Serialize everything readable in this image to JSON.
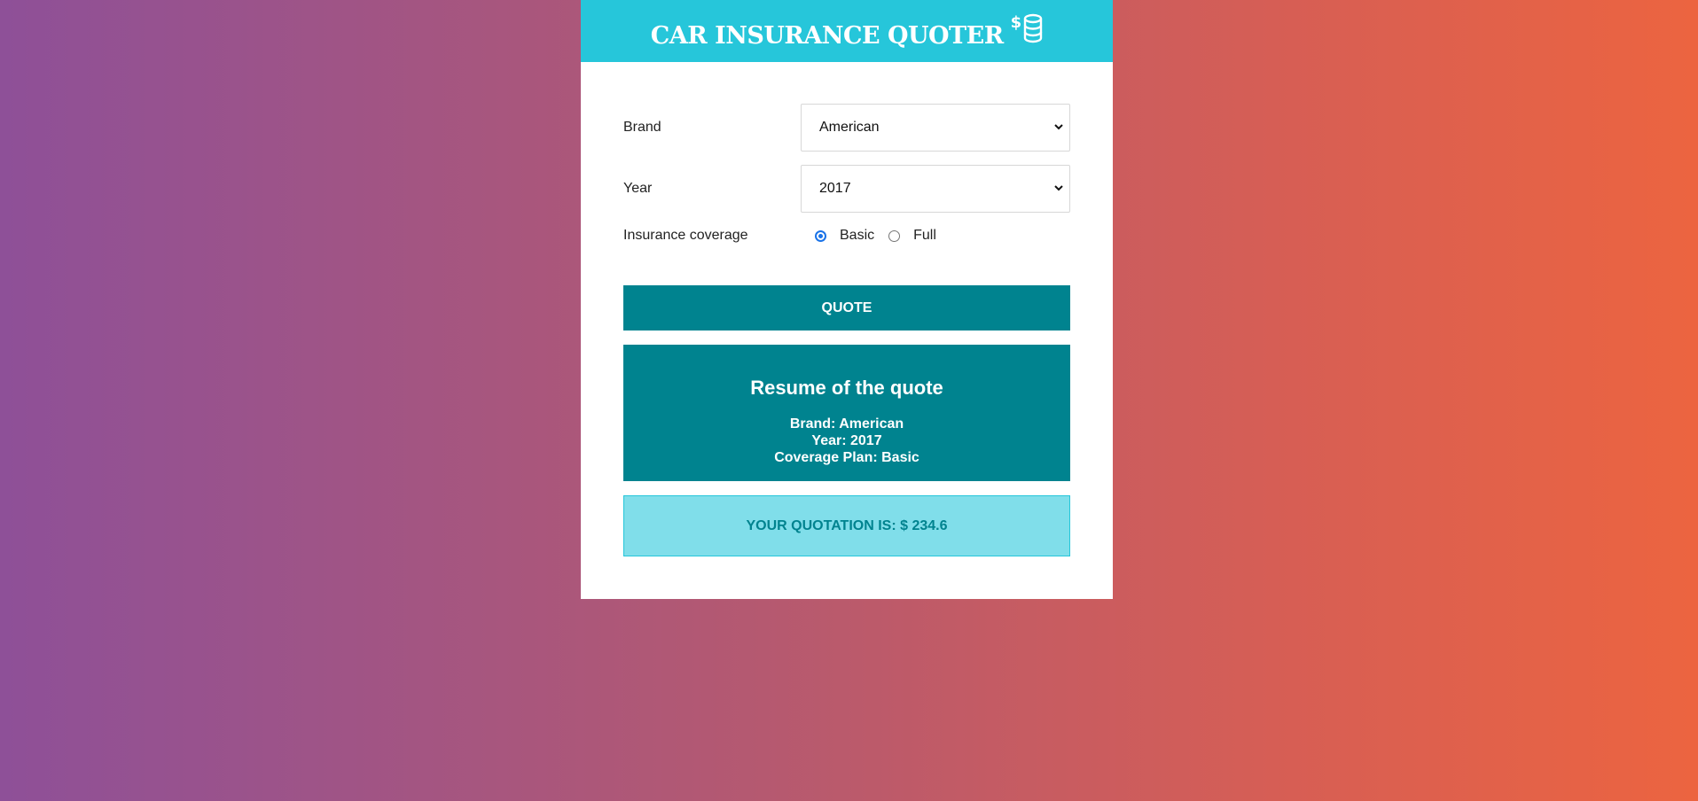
{
  "header": {
    "title": "CAR INSURANCE QUOTER",
    "icon_dollar": "$",
    "icon": "coins-icon"
  },
  "form": {
    "brand": {
      "label": "Brand",
      "value": "American"
    },
    "year": {
      "label": "Year",
      "value": "2017"
    },
    "coverage": {
      "label": "Insurance coverage",
      "options": [
        {
          "label": "Basic",
          "checked": true
        },
        {
          "label": "Full",
          "checked": false
        }
      ]
    },
    "quote_button": "QUOTE"
  },
  "summary": {
    "title": "Resume of the quote",
    "brand_line": "Brand: American",
    "year_line": "Year: 2017",
    "coverage_line": "Coverage Plan: Basic"
  },
  "result": {
    "text": "YOUR QUOTATION IS: $ 234.6"
  },
  "colors": {
    "header": "#26c6da",
    "primary": "#00838f",
    "result_bg": "#80deea"
  }
}
